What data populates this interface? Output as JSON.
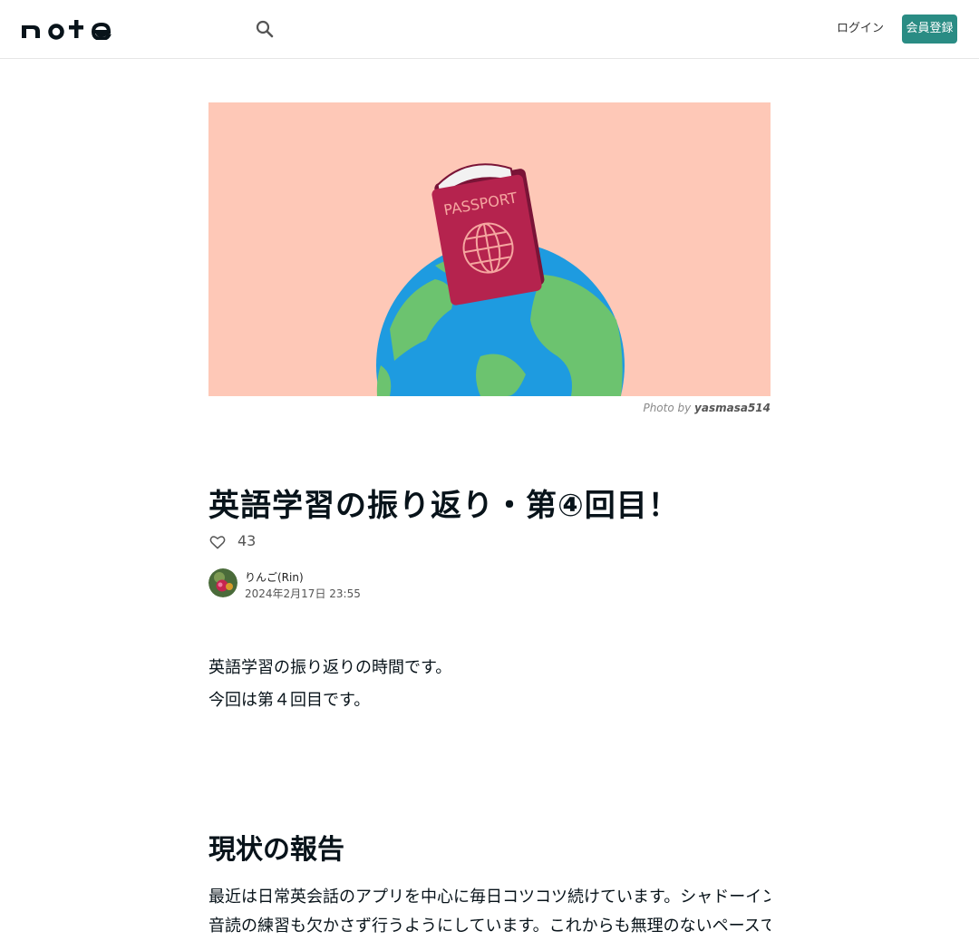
{
  "header": {
    "logo": "note",
    "login_label": "ログイン",
    "signup_label": "会員登録"
  },
  "hero": {
    "passport_text": "PASSPORT",
    "credit_prefix": "Photo by",
    "credit_author": "yasmasa514"
  },
  "article": {
    "title": "英語学習の振り返り・第④回目！",
    "like_count": "43",
    "author": "りんご(Rin)",
    "date": "2024年2月17日 23:55",
    "intro_line1": "英語学習の振り返りの時間です。",
    "intro_line2": "今回は第４回目です。",
    "section_heading": "現状の報告",
    "body_line1": "最近は日常英会話のアプリを中心に毎日コツコツ続けています。シャドーイングも少しずつ取り入れて、",
    "body_line2": "音読の練習も欠かさず行うようにしています。これからも無理のないペースで楽しく学習を続けていきます。"
  },
  "colors": {
    "accent": "#2a8c84",
    "hero_bg": "#fec8b7",
    "passport": "#b5234e",
    "ocean": "#1e9be0",
    "land": "#6cc36f"
  },
  "icons": {
    "search": "search-icon",
    "like": "heart-icon"
  }
}
